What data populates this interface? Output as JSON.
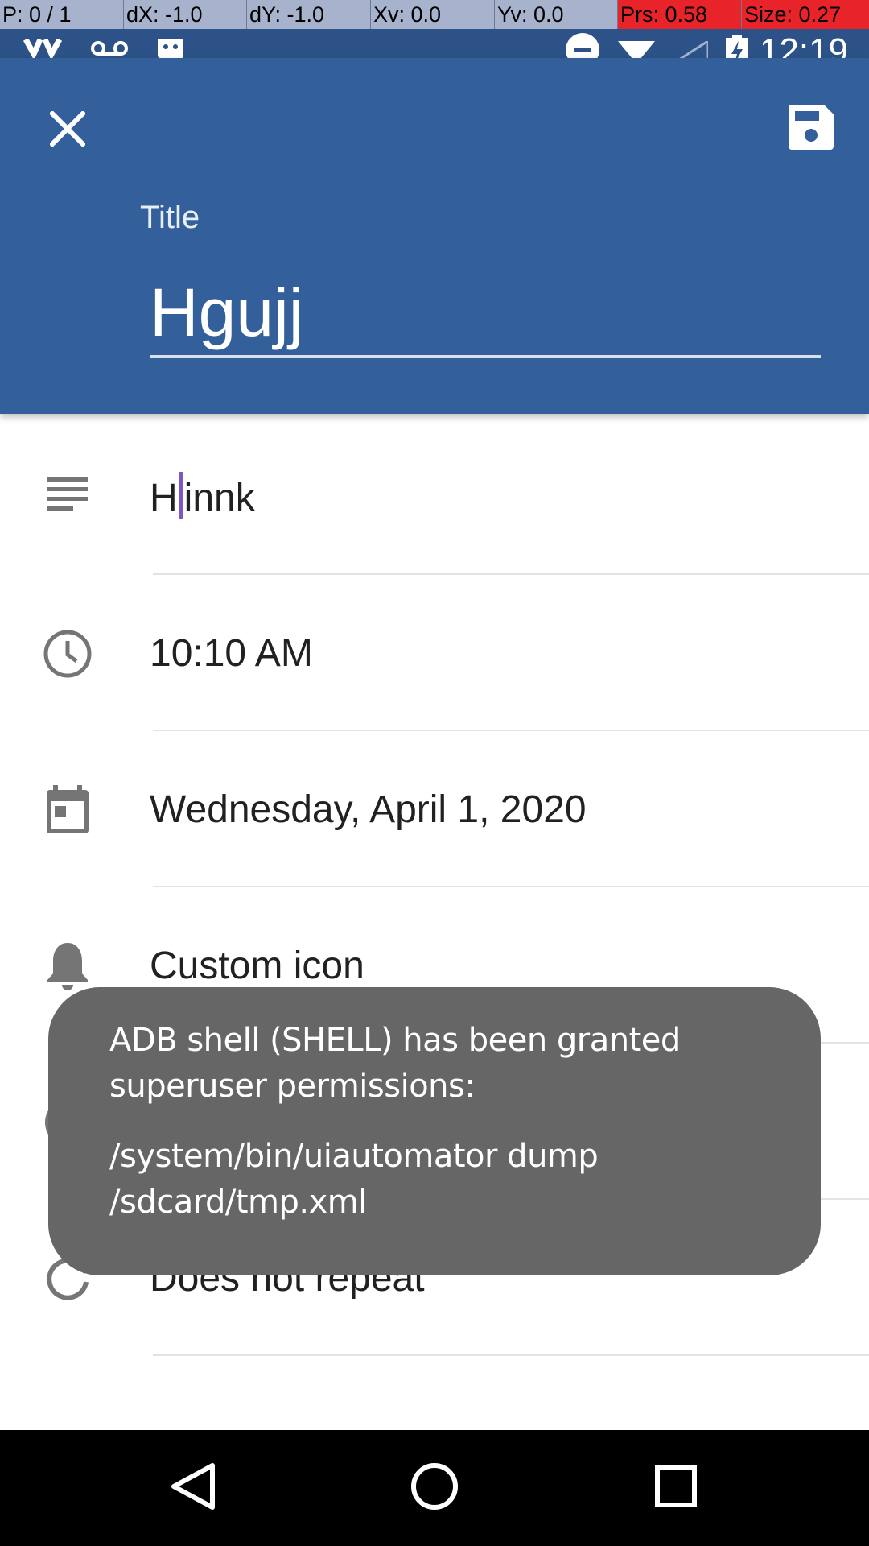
{
  "pointer_overlay": {
    "cells": [
      "P: 0 / 1",
      "dX: -1.0",
      "dY: -1.0",
      "Xv: 0.0",
      "Yv: 0.0",
      "Prs: 0.58",
      "Size: 0.27"
    ]
  },
  "status_bar": {
    "time": "12:19",
    "left_icons": [
      "app-icon",
      "voicemail-icon",
      "android-icon"
    ],
    "right_icons": [
      "do-not-disturb-icon",
      "wifi-icon",
      "signal-icon",
      "battery-charging-icon"
    ]
  },
  "app_bar": {
    "color": "#335f9a",
    "close_icon": "close-icon",
    "save_icon": "save-icon",
    "title_label": "Title",
    "title_value": "Hgujj"
  },
  "form": {
    "description": {
      "icon": "notes-icon",
      "before_caret": "H",
      "after_caret": "innk"
    },
    "time": {
      "icon": "clock-icon",
      "value": "10:10 AM"
    },
    "date": {
      "icon": "calendar-icon",
      "value": "Wednesday, April 1, 2020"
    },
    "reminder": {
      "icon": "bell-icon",
      "value": "Custom icon"
    },
    "color": {
      "icon": "palette-icon",
      "value": "#8e8e8e"
    },
    "repeat": {
      "icon": "repeat-icon",
      "value": "Does not repeat"
    }
  },
  "toast": {
    "line1": "ADB shell (SHELL) has been granted superuser permissions:",
    "line2": "/system/bin/uiautomator dump /sdcard/tmp.xml"
  },
  "nav_bar": {
    "back_icon": "back-icon",
    "home_icon": "home-icon",
    "recents_icon": "recents-icon"
  }
}
